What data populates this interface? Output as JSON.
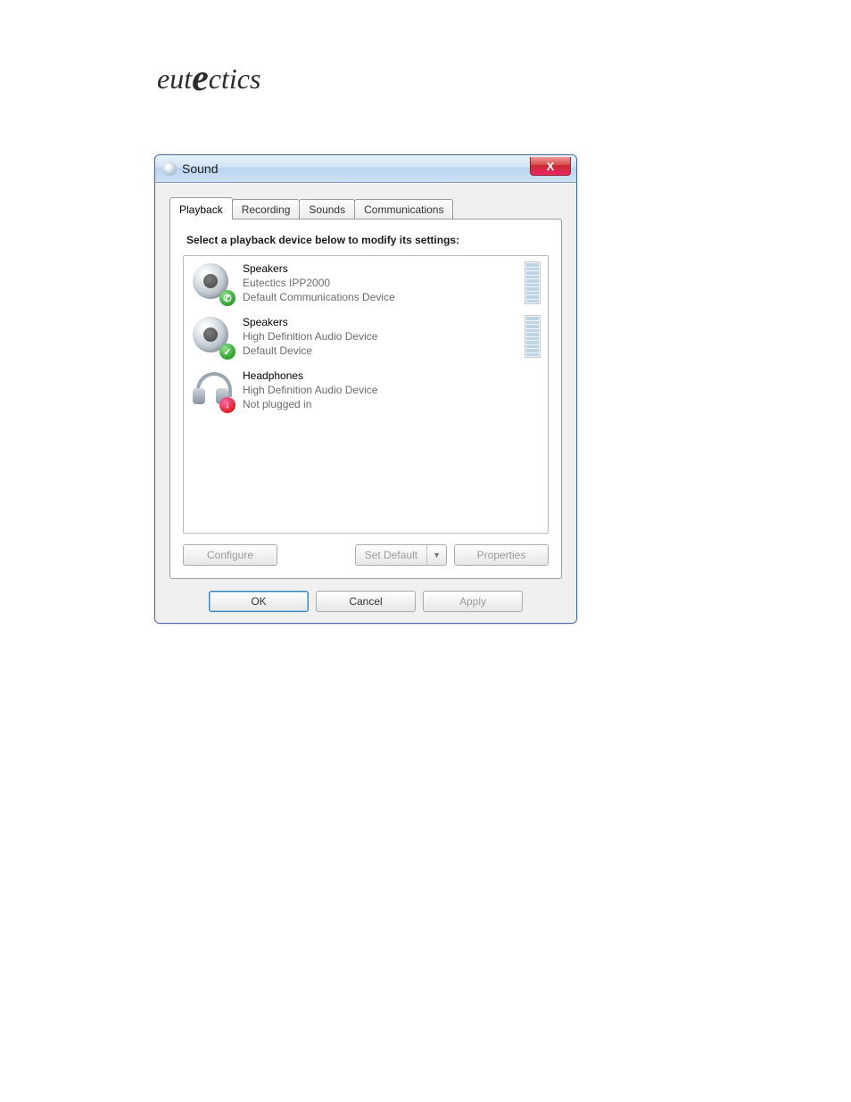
{
  "logo": {
    "pre": "eut",
    "mid": "e",
    "post": "ctics"
  },
  "window": {
    "title": "Sound",
    "close_glyph": "X",
    "tabs": [
      "Playback",
      "Recording",
      "Sounds",
      "Communications"
    ],
    "active_tab": 0,
    "prompt": "Select a playback device below to modify its settings:",
    "devices": [
      {
        "name": "Speakers",
        "sub": "Eutectics IPP2000",
        "status": "Default Communications Device",
        "icon": "speaker",
        "overlay": "phone",
        "meter": true
      },
      {
        "name": "Speakers",
        "sub": "High Definition Audio Device",
        "status": "Default Device",
        "icon": "speaker",
        "overlay": "check",
        "meter": true
      },
      {
        "name": "Headphones",
        "sub": "High Definition Audio Device",
        "status": "Not plugged in",
        "icon": "headphones",
        "overlay": "down",
        "meter": false
      }
    ],
    "buttons": {
      "configure": "Configure",
      "set_default": "Set Default",
      "properties": "Properties",
      "ok": "OK",
      "cancel": "Cancel",
      "apply": "Apply"
    }
  }
}
